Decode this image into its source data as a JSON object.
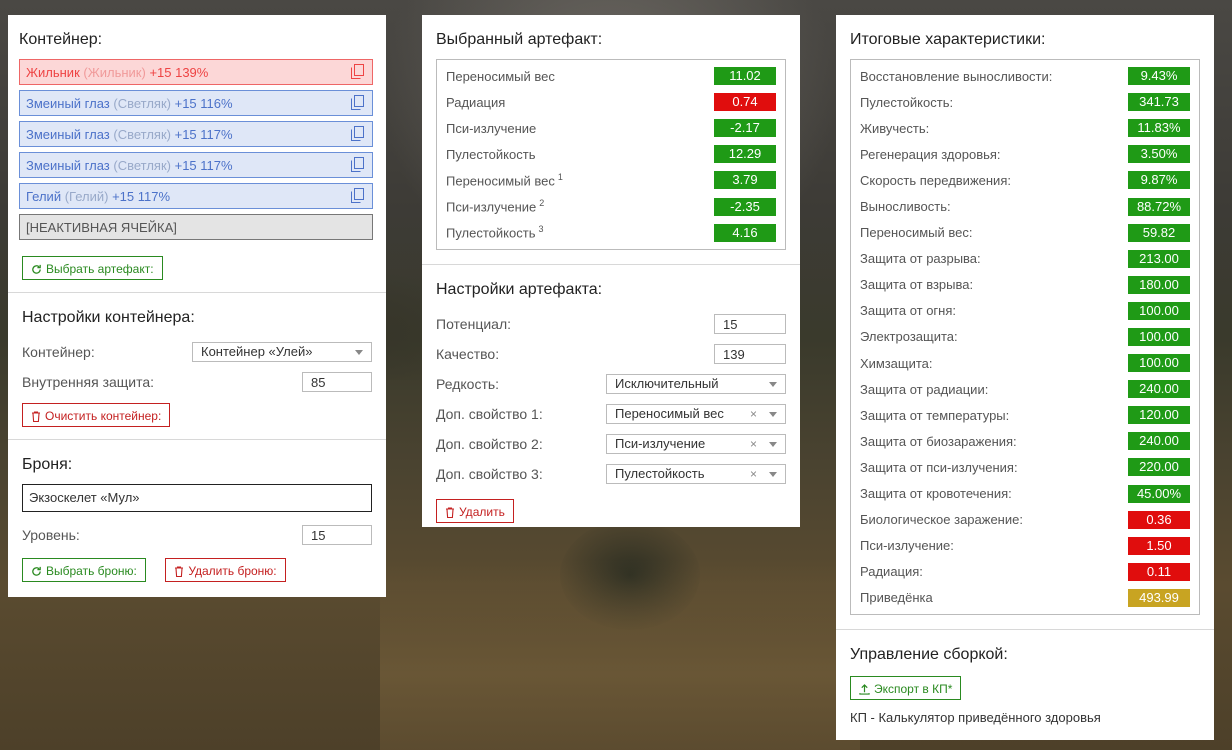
{
  "colors": {
    "green": "#1f9a16",
    "red": "#e00d0d",
    "gold": "#c8a422",
    "slot_red": "#fcd7d7",
    "slot_blue": "#dfe7f7"
  },
  "container": {
    "title": "Контейнер:",
    "slots": [
      {
        "name": "Жильник",
        "sub": "(Жильник)",
        "extra": "+15 139%",
        "style": "red"
      },
      {
        "name": "Змеиный глаз",
        "sub": "(Светляк)",
        "extra": "+15 116%",
        "style": "blue"
      },
      {
        "name": "Змеиный глаз",
        "sub": "(Светляк)",
        "extra": "+15 117%",
        "style": "blue"
      },
      {
        "name": "Змеиный глаз",
        "sub": "(Светляк)",
        "extra": "+15 117%",
        "style": "blue"
      },
      {
        "name": "Гелий",
        "sub": "(Гелий)",
        "extra": "+15 117%",
        "style": "blue"
      }
    ],
    "inactive_slot": "[НЕАКТИВНАЯ ЯЧЕЙКА]",
    "select_button": "Выбрать артефакт:"
  },
  "container_settings": {
    "title": "Настройки контейнера:",
    "container_label": "Контейнер:",
    "container_value": "Контейнер «Улей»",
    "protection_label": "Внутренняя защита:",
    "protection_value": "85",
    "clear_button": "Очистить контейнер:"
  },
  "armor": {
    "title": "Броня:",
    "value": "Экзоскелет «Мул»",
    "level_label": "Уровень:",
    "level_value": "15",
    "select_button": "Выбрать броню:",
    "delete_button": "Удалить броню:"
  },
  "selected_artifact": {
    "title": "Выбранный артефакт:",
    "stats": [
      {
        "label": "Переносимый вес",
        "sup": "",
        "value": "11.02",
        "color": "green"
      },
      {
        "label": "Радиация",
        "sup": "",
        "value": "0.74",
        "color": "red"
      },
      {
        "label": "Пси-излучение",
        "sup": "",
        "value": "-2.17",
        "color": "green"
      },
      {
        "label": "Пулестойкость",
        "sup": "",
        "value": "12.29",
        "color": "green"
      },
      {
        "label": "Переносимый вес",
        "sup": "1",
        "value": "3.79",
        "color": "green"
      },
      {
        "label": "Пси-излучение",
        "sup": "2",
        "value": "-2.35",
        "color": "green"
      },
      {
        "label": "Пулестойкость",
        "sup": "3",
        "value": "4.16",
        "color": "green"
      }
    ]
  },
  "artifact_settings": {
    "title": "Настройки артефакта:",
    "potential_label": "Потенциал:",
    "potential_value": "15",
    "quality_label": "Качество:",
    "quality_value": "139",
    "rarity_label": "Редкость:",
    "rarity_value": "Исключительный",
    "prop1_label": "Доп. свойство 1:",
    "prop1_value": "Переносимый вес",
    "prop2_label": "Доп. свойство 2:",
    "prop2_value": "Пси-излучение",
    "prop3_label": "Доп. свойство 3:",
    "prop3_value": "Пулестойкость",
    "clear_mark": "×",
    "delete_button": "Удалить"
  },
  "totals": {
    "title": "Итоговые характеристики:",
    "stats": [
      {
        "label": "Восстановление выносливости:",
        "value": "9.43%",
        "color": "green"
      },
      {
        "label": "Пулестойкость:",
        "value": "341.73",
        "color": "green"
      },
      {
        "label": "Живучесть:",
        "value": "11.83%",
        "color": "green"
      },
      {
        "label": "Регенерация здоровья:",
        "value": "3.50%",
        "color": "green"
      },
      {
        "label": "Скорость передвижения:",
        "value": "9.87%",
        "color": "green"
      },
      {
        "label": "Выносливость:",
        "value": "88.72%",
        "color": "green"
      },
      {
        "label": "Переносимый вес:",
        "value": "59.82",
        "color": "green"
      },
      {
        "label": "Защита от разрыва:",
        "value": "213.00",
        "color": "green"
      },
      {
        "label": "Защита от взрыва:",
        "value": "180.00",
        "color": "green"
      },
      {
        "label": "Защита от огня:",
        "value": "100.00",
        "color": "green"
      },
      {
        "label": "Электрозащита:",
        "value": "100.00",
        "color": "green"
      },
      {
        "label": "Химзащита:",
        "value": "100.00",
        "color": "green"
      },
      {
        "label": "Защита от радиации:",
        "value": "240.00",
        "color": "green"
      },
      {
        "label": "Защита от температуры:",
        "value": "120.00",
        "color": "green"
      },
      {
        "label": "Защита от биозаражения:",
        "value": "240.00",
        "color": "green"
      },
      {
        "label": "Защита от пси-излучения:",
        "value": "220.00",
        "color": "green"
      },
      {
        "label": "Защита от кровотечения:",
        "value": "45.00%",
        "color": "green"
      },
      {
        "label": "Биологическое заражение:",
        "value": "0.36",
        "color": "red"
      },
      {
        "label": "Пси-излучение:",
        "value": "1.50",
        "color": "red"
      },
      {
        "label": "Радиация:",
        "value": "0.11",
        "color": "red"
      },
      {
        "label": "Приведёнка",
        "value": "493.99",
        "color": "gold"
      }
    ]
  },
  "build": {
    "title": "Управление сборкой:",
    "export_button": "Экспорт в КП*",
    "note": "КП - Калькулятор приведённого здоровья"
  }
}
